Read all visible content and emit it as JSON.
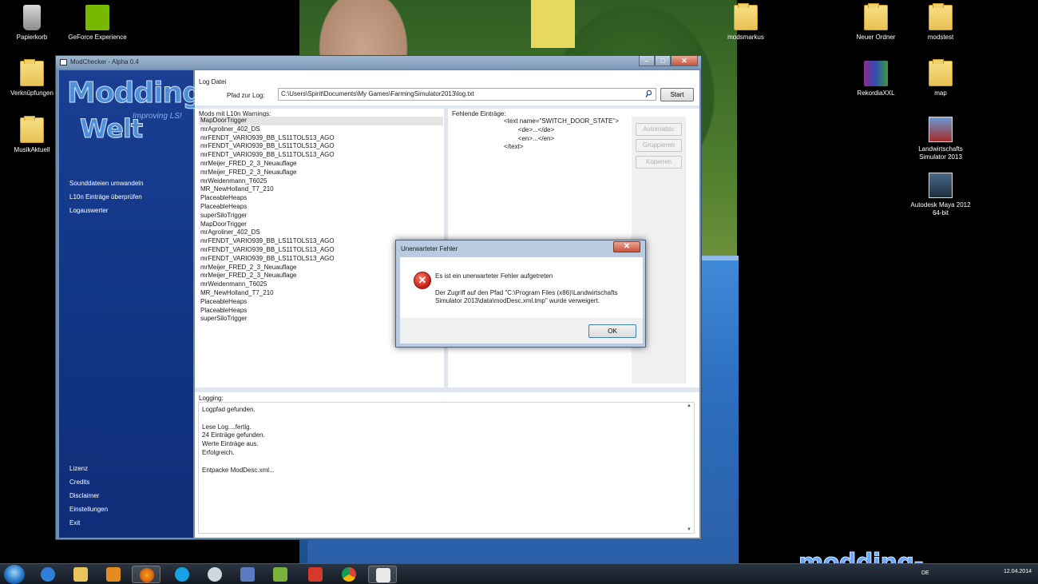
{
  "desktop": {
    "icons": [
      {
        "label": "Papierkorb",
        "icon": "recycle-bin-icon"
      },
      {
        "label": "GeForce Experience",
        "icon": "nvidia-icon"
      },
      {
        "label": "Verknüpfungen",
        "icon": "folder-icon"
      },
      {
        "label": "MusikAktuell",
        "icon": "folder-icon"
      },
      {
        "label": "modsmarkus",
        "icon": "folder-icon"
      },
      {
        "label": "Neuer Ordner",
        "icon": "folder-icon"
      },
      {
        "label": "modstest",
        "icon": "folder-icon"
      },
      {
        "label": "RekordiaXXL",
        "icon": "winrar-icon"
      },
      {
        "label": "map",
        "icon": "folder-icon"
      },
      {
        "label": "Landwirtschafts Simulator 2013",
        "icon": "farming-simulator-icon"
      },
      {
        "label": "Autodesk Maya 2012 64-bit",
        "icon": "maya-icon"
      }
    ],
    "watermark": "modding-welt.com"
  },
  "window": {
    "title": "ModChecker - Alpha 0.4",
    "controls": {
      "minimize": "–",
      "maximize": "□",
      "close": "✕"
    }
  },
  "sidebar": {
    "logo_line1": "Modding",
    "logo_line2": "Welt",
    "logo_tagline": "Improving LS!",
    "nav_top": [
      "Sounddateien umwandeln",
      "L10n Einträge überprüfen",
      "Logauswerter"
    ],
    "nav_bottom": [
      "Lizenz",
      "Credits",
      "Disclaimer",
      "Einstellungen",
      "Exit"
    ]
  },
  "log_file": {
    "section_label": "Log Datei",
    "path_label": "Pfad zur Log:",
    "path_value": "C:\\Users\\Spirit\\Documents\\My Games\\FarmingSimulator2013\\log.txt",
    "start_button": "Start"
  },
  "mods": {
    "header": "Mods mit L10n Warnings:",
    "items": [
      "MapDoorTrigger",
      "mrAgroliner_402_DS",
      "mrFENDT_VARIO939_BB_LS11TOLS13_AGO",
      "mrFENDT_VARIO939_BB_LS11TOLS13_AGO",
      "mrFENDT_VARIO939_BB_LS11TOLS13_AGO",
      "mrMeijer_FRED_2_3_Neuauflage",
      "mrMeijer_FRED_2_3_Neuauflage",
      "mrWeidenmann_T6025",
      "MR_NewHolland_T7_210",
      "PlaceableHeaps",
      "PlaceableHeaps",
      "superSiloTrigger",
      "MapDoorTrigger",
      "mrAgroliner_402_DS",
      "mrFENDT_VARIO939_BB_LS11TOLS13_AGO",
      "mrFENDT_VARIO939_BB_LS11TOLS13_AGO",
      "mrFENDT_VARIO939_BB_LS11TOLS13_AGO",
      "mrMeijer_FRED_2_3_Neuauflage",
      "mrMeijer_FRED_2_3_Neuauflage",
      "mrWeidenmann_T6025",
      "MR_NewHolland_T7_210",
      "PlaceableHeaps",
      "PlaceableHeaps",
      "superSiloTrigger"
    ]
  },
  "missing": {
    "header": "Fehlende Einträge:",
    "xml_lines": [
      "<text name=\"SWITCH_DOOR_STATE\">",
      "        <de>...</de>",
      "        <en>...</en>",
      "</text>"
    ],
    "buttons": [
      "Automatisc",
      "Gruppieren",
      "Kopieren"
    ]
  },
  "logging": {
    "header": "Logging:",
    "lines": [
      "Logpfad gefunden.",
      "",
      "Lese Log....fertig.",
      "24 Einträge gefunden.",
      "Werte Einträge aus.",
      "Erfolgreich.",
      "",
      "Entpacke ModDesc.xml..."
    ]
  },
  "dialog": {
    "title": "Unerwarteter Fehler",
    "close": "✕",
    "headline": "Es ist ein unerwarteter Fehler aufgetreten",
    "message_line1": "Der Zugriff auf den Pfad \"C:\\Program Files (x86)\\Landwirtschafts",
    "message_line2": "Simulator 2013\\data\\modDesc.xml.tmp\" wurde verweigert.",
    "ok_button": "OK"
  },
  "taskbar": {
    "apps": [
      "start-orb-icon",
      "internet-explorer-icon",
      "explorer-icon",
      "media-player-icon",
      "firefox-icon",
      "skype-icon",
      "steam-icon",
      "paint-icon",
      "notepadpp-icon",
      "flashget-icon",
      "chrome-icon",
      "modchecker-icon"
    ],
    "lang": "DE",
    "date": "12.04.2014"
  },
  "colors": {
    "sidebar": "#123585",
    "window_frame": "#7e9ab8",
    "error_red": "#c31e12",
    "watermark": "#6aa8ff"
  }
}
